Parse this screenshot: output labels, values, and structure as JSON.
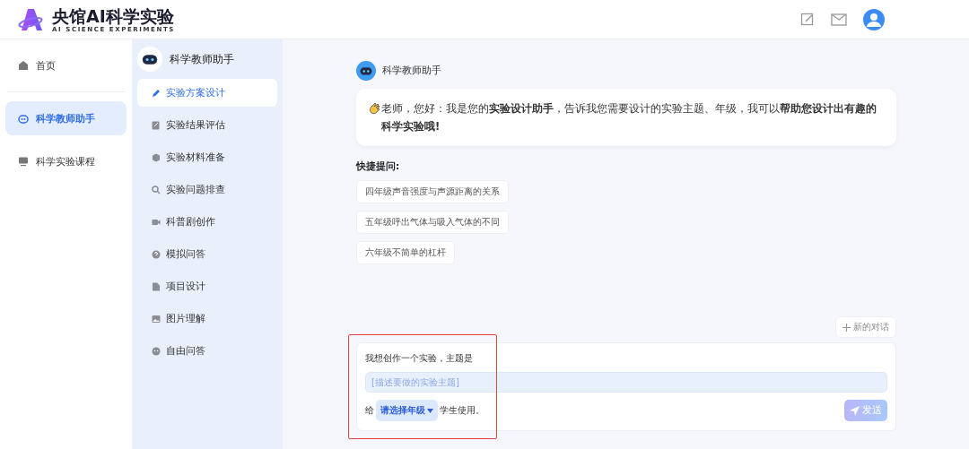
{
  "header": {
    "logo_title": "央馆AI科学实验",
    "logo_subtitle": "AI SCIENCE EXPERIMENTS"
  },
  "nav": [
    {
      "label": "首页",
      "selected": false
    },
    {
      "label": "科学教师助手",
      "selected": true
    },
    {
      "label": "科学实验课程",
      "selected": false
    }
  ],
  "assistant": {
    "title": "科学教师助手",
    "items": [
      {
        "label": "实验方案设计",
        "selected": true
      },
      {
        "label": "实验结果评估",
        "selected": false
      },
      {
        "label": "实验材料准备",
        "selected": false
      },
      {
        "label": "实验问题排查",
        "selected": false
      },
      {
        "label": "科普剧创作",
        "selected": false
      },
      {
        "label": "模拟问答",
        "selected": false
      },
      {
        "label": "项目设计",
        "selected": false
      },
      {
        "label": "图片理解",
        "selected": false
      },
      {
        "label": "自由问答",
        "selected": false
      }
    ]
  },
  "chat": {
    "bot_name": "科学教师助手",
    "greeting": "老师，您好：我是您的**实验设计助手**，告诉我您需要设计的实验主题、年级，我可以**帮助您设计出有趣的科学实验哦!**",
    "quick_title": "快捷提问:",
    "quick_questions": [
      "四年级声音强度与声源距离的关系",
      "五年级呼出气体与吸入气体的不同",
      "六年级不简单的杠杆"
    ],
    "new_chat": "新的对话",
    "composer": {
      "line_1": "我想创作一个实验，主题是",
      "topic_placeholder": "[描述要做的实验主题]",
      "prefix": "给",
      "grade_select": "请选择年级",
      "suffix": "学生使用。",
      "send": "发送",
      "send_disabled": true
    }
  }
}
